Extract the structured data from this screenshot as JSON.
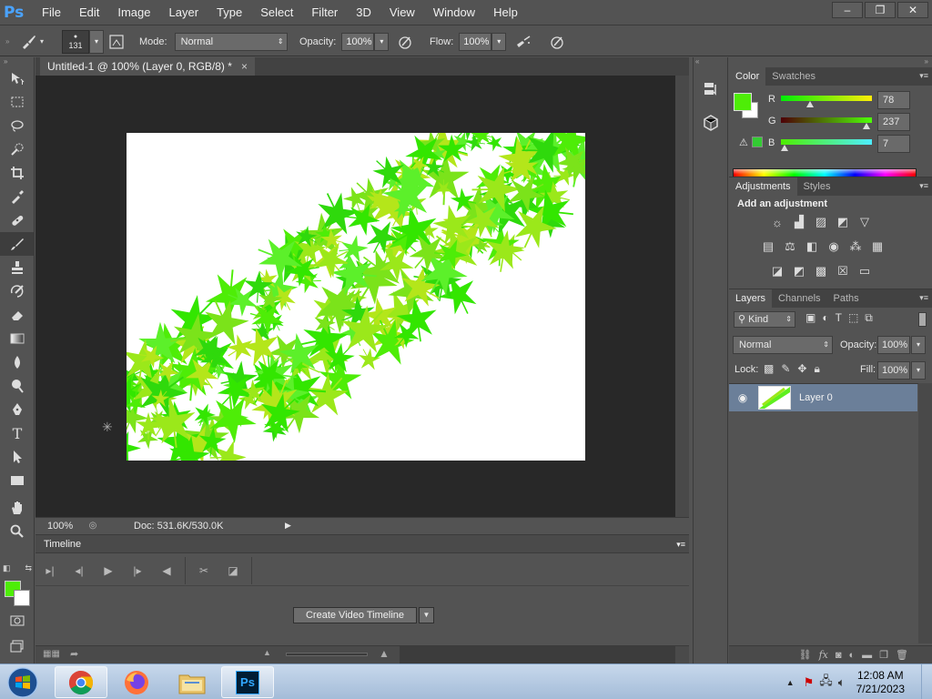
{
  "app": {
    "logo": "Ps"
  },
  "menu": [
    "File",
    "Edit",
    "Image",
    "Layer",
    "Type",
    "Select",
    "Filter",
    "3D",
    "View",
    "Window",
    "Help"
  ],
  "window_controls": {
    "minimize": "‒",
    "restore": "❐",
    "close": "✕"
  },
  "options": {
    "brush_size": "131",
    "mode_label": "Mode:",
    "mode_value": "Normal",
    "opacity_label": "Opacity:",
    "opacity_value": "100%",
    "flow_label": "Flow:",
    "flow_value": "100%"
  },
  "document": {
    "tab_title": "Untitled-1 @ 100% (Layer 0, RGB/8) *",
    "tab_close": "×",
    "zoom": "100%",
    "doc_info": "Doc: 531.6K/530.0K"
  },
  "timeline": {
    "title": "Timeline",
    "create_button": "Create Video Timeline"
  },
  "color_panel": {
    "tabs": [
      "Color",
      "Swatches"
    ],
    "fg_color": "#4eed07",
    "bg_color": "#ffffff",
    "r_label": "R",
    "r_value": "78",
    "g_label": "G",
    "g_value": "237",
    "b_label": "B",
    "b_value": "7"
  },
  "adjustments_panel": {
    "tabs": [
      "Adjustments",
      "Styles"
    ],
    "title": "Add an adjustment"
  },
  "layers_panel": {
    "tabs": [
      "Layers",
      "Channels",
      "Paths"
    ],
    "filter_kind": "Kind",
    "blend_mode": "Normal",
    "opacity_label": "Opacity:",
    "opacity_value": "100%",
    "lock_label": "Lock:",
    "fill_label": "Fill:",
    "fill_value": "100%",
    "layers": [
      {
        "name": "Layer 0",
        "visible": true
      }
    ]
  },
  "taskbar": {
    "time": "12:08 AM",
    "date": "7/21/2023"
  }
}
